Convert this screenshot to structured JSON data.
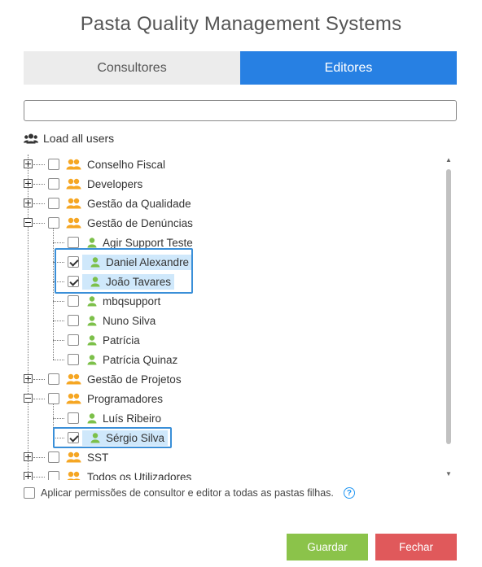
{
  "title": "Pasta Quality Management Systems",
  "tabs": [
    {
      "label": "Consultores",
      "active": false
    },
    {
      "label": "Editores",
      "active": true
    }
  ],
  "search": {
    "value": "",
    "placeholder": ""
  },
  "load_users": {
    "label": "Load all users",
    "icon": "users-icon"
  },
  "tree": {
    "groups": [
      {
        "label": "Conselho Fiscal",
        "expanded": false,
        "icon": "group-icon"
      },
      {
        "label": "Developers",
        "expanded": false,
        "icon": "group-icon"
      },
      {
        "label": "Gestão da Qualidade",
        "expanded": false,
        "icon": "group-icon"
      },
      {
        "label": "Gestão de Denúncias",
        "expanded": true,
        "icon": "group-icon",
        "users": [
          {
            "label": "Agir Support Teste",
            "checked": false
          },
          {
            "label": "Daniel Alexandre",
            "checked": true
          },
          {
            "label": "João Tavares",
            "checked": true
          },
          {
            "label": "mbqsupport",
            "checked": false
          },
          {
            "label": "Nuno Silva",
            "checked": false
          },
          {
            "label": "Patrícia",
            "checked": false
          },
          {
            "label": "Patrícia Quinaz",
            "checked": false
          }
        ]
      },
      {
        "label": "Gestão de Projetos",
        "expanded": false,
        "icon": "group-icon"
      },
      {
        "label": "Programadores",
        "expanded": true,
        "icon": "group-icon",
        "users": [
          {
            "label": "Luís Ribeiro",
            "checked": false
          },
          {
            "label": "Sérgio Silva",
            "checked": true
          }
        ]
      },
      {
        "label": "SST",
        "expanded": false,
        "icon": "group-icon"
      },
      {
        "label": "Todos os Utilizadores",
        "expanded": false,
        "icon": "group-icon"
      }
    ]
  },
  "apply_children": {
    "label": "Aplicar permissões de consultor e editor a todas as pastas filhas.",
    "checked": false,
    "help_label": "?"
  },
  "buttons": {
    "save_label": "Guardar",
    "close_label": "Fechar"
  },
  "colors": {
    "accent": "#2780e3",
    "group_icon": "#f5a623",
    "user_icon": "#7cc04a",
    "save": "#8bc34a",
    "close": "#e0595b",
    "selection": "#cfe8fb",
    "highlight_border": "#3a8fd8"
  }
}
